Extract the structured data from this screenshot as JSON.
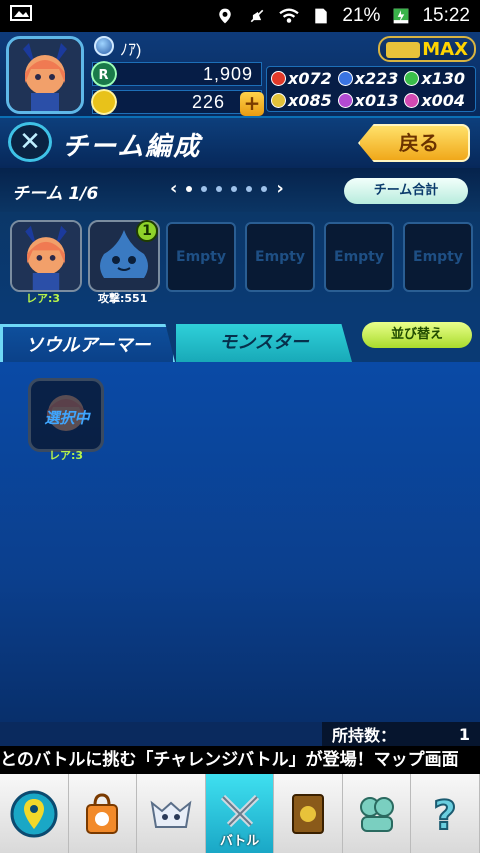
{
  "status_bar": {
    "battery": "21%",
    "time": "15:22"
  },
  "player": {
    "name": "ﾉｱ)",
    "currency_r": "1,909",
    "coins": "226",
    "tickets": "MAX"
  },
  "materials": [
    {
      "icon": "red-orb-icon",
      "color": "#e23a2a",
      "count": "x072"
    },
    {
      "icon": "blue-orb-icon",
      "color": "#3a74e2",
      "count": "x223"
    },
    {
      "icon": "green-orb-icon",
      "color": "#3abe4a",
      "count": "x130"
    },
    {
      "icon": "yellow-orb-icon",
      "color": "#e2c23a",
      "count": "x085"
    },
    {
      "icon": "purple-orb-icon",
      "color": "#b24ad2",
      "count": "x013"
    },
    {
      "icon": "rainbow-orb-icon",
      "color": "#d24ab2",
      "count": "x004"
    }
  ],
  "title_bar": {
    "title": "チーム編成",
    "back_label": "戻る"
  },
  "team": {
    "label": "チーム 1/6",
    "prev": "‹",
    "next": "›",
    "total_label": "チーム合計",
    "slot_char_caption": "レア:3",
    "slot_mon_caption": "攻撃:551",
    "slot_mon_level": "1",
    "empty_label": "Empty"
  },
  "tabs": {
    "soul_armor": "ソウルアーマー",
    "monster": "モンスター",
    "sort_label": "並び替え"
  },
  "list": {
    "item_selected_label": "選択中",
    "item_level": "レア:3"
  },
  "count": {
    "label": "所持数：",
    "value": "1"
  },
  "ticker": "とのバトルに挑む「チャレンジバトル」が登場！マップ画面",
  "bottom_nav": {
    "battle_label": "バトル"
  },
  "colors": {
    "accent": "#3fc2e6",
    "back_button": "#f0a81a",
    "active_tab": "#1aa7c6"
  }
}
